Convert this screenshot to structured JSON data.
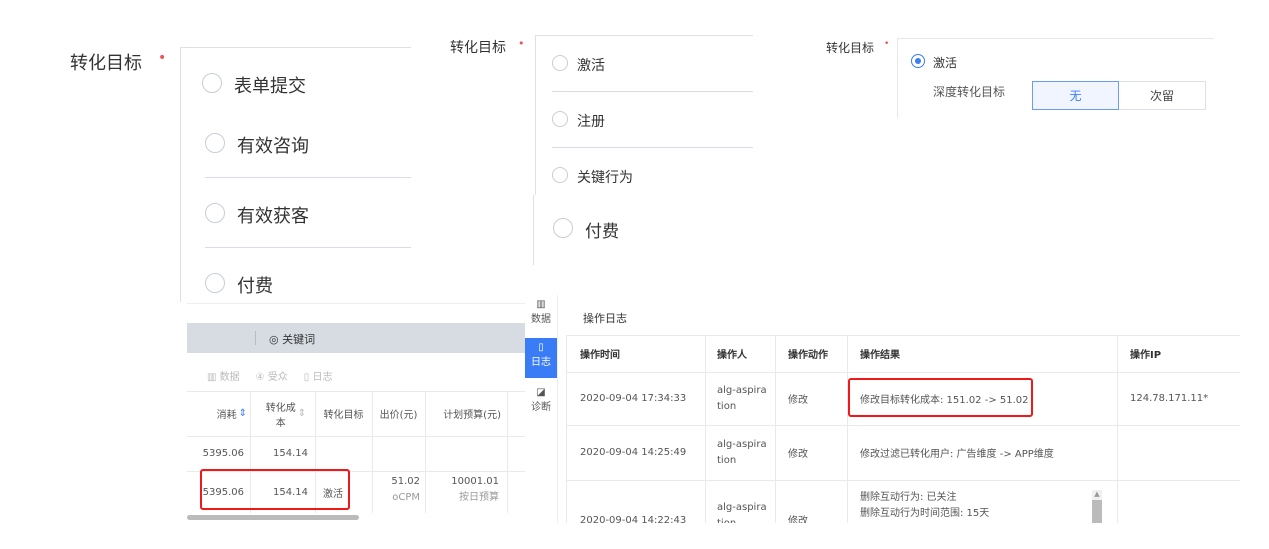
{
  "panel1": {
    "label": "转化目标",
    "required": "•",
    "options": [
      "表单提交",
      "有效咨询",
      "有效获客",
      "付费"
    ]
  },
  "panel2": {
    "label": "转化目标",
    "required": "•",
    "options": [
      "激活",
      "注册",
      "关键行为",
      "付费"
    ]
  },
  "panel3": {
    "label": "转化目标",
    "required": "•",
    "option": "激活",
    "deep_label": "深度转化目标",
    "deep_options": [
      "无",
      "次留"
    ],
    "deep_selected": "无"
  },
  "report": {
    "tab": "关键词",
    "subtabs": [
      "数据",
      "受众",
      "日志"
    ],
    "columns": [
      "消耗",
      "转化成本",
      "转化目标",
      "出价(元)",
      "计划预算(元)"
    ],
    "rows": [
      {
        "spend": "5395.06",
        "cost": "154.14",
        "goal": "",
        "bid": "",
        "bid_type": "",
        "budget": "",
        "budget_type": ""
      },
      {
        "spend": "5395.06",
        "cost": "154.14",
        "goal": "激活",
        "bid": "51.02",
        "bid_type": "oCPM",
        "budget": "10001.01",
        "budget_type": "按日预算"
      }
    ]
  },
  "log": {
    "nav": [
      "数据",
      "日志",
      "诊断"
    ],
    "title": "操作日志",
    "columns": [
      "操作时间",
      "操作人",
      "操作动作",
      "操作结果",
      "操作IP"
    ],
    "rows": [
      {
        "time": "2020-09-04 17:34:33",
        "user": "alg-aspiration",
        "action": "修改",
        "result": "修改目标转化成本: 151.02 -> 51.02",
        "ip": "124.78.171.11*"
      },
      {
        "time": "2020-09-04 14:25:49",
        "user": "alg-aspiration",
        "action": "修改",
        "result": "修改过滤已转化用户: 广告维度 -> APP维度",
        "ip": ""
      },
      {
        "time": "2020-09-04 14:22:43",
        "user": "alg-aspiration",
        "action": "修改",
        "result": "删除互动行为: 已关注",
        "result2": "删除互动行为时间范围: 15天",
        "ip": ""
      }
    ]
  },
  "colors": {
    "accent": "#3a7cf5",
    "highlight": "#f01818"
  }
}
